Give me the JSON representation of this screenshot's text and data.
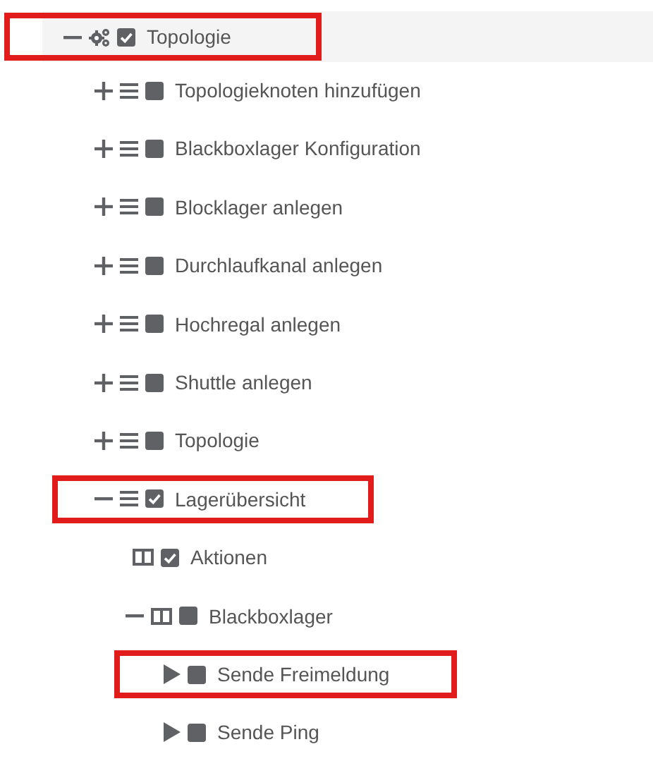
{
  "tree": [
    {
      "label": "Topologie",
      "kind": "module",
      "checked": true,
      "expanded": true,
      "selected": true,
      "highlighted": true,
      "children": [
        {
          "label": "Topologieknoten hinzufügen",
          "kind": "page",
          "checked": false,
          "expanded": false,
          "selected": false,
          "highlighted": false
        },
        {
          "label": "Blackboxlager Konfiguration",
          "kind": "page",
          "checked": false,
          "expanded": false,
          "selected": false,
          "highlighted": false
        },
        {
          "label": "Blocklager anlegen",
          "kind": "page",
          "checked": false,
          "expanded": false,
          "selected": false,
          "highlighted": false
        },
        {
          "label": "Durchlaufkanal anlegen",
          "kind": "page",
          "checked": false,
          "expanded": false,
          "selected": false,
          "highlighted": false
        },
        {
          "label": "Hochregal anlegen",
          "kind": "page",
          "checked": false,
          "expanded": false,
          "selected": false,
          "highlighted": false
        },
        {
          "label": "Shuttle anlegen",
          "kind": "page",
          "checked": false,
          "expanded": false,
          "selected": false,
          "highlighted": false
        },
        {
          "label": "Topologie",
          "kind": "page",
          "checked": false,
          "expanded": false,
          "selected": false,
          "highlighted": false
        },
        {
          "label": "Lagerübersicht",
          "kind": "page",
          "checked": true,
          "expanded": true,
          "selected": false,
          "highlighted": true,
          "children": [
            {
              "label": "Aktionen",
              "kind": "panel",
              "checked": true,
              "selected": false,
              "highlighted": false
            },
            {
              "label": "Blackboxlager",
              "kind": "panel",
              "checked": false,
              "expanded": true,
              "selected": false,
              "highlighted": false,
              "children": [
                {
                  "label": "Sende Freimeldung",
                  "kind": "action",
                  "checked": false,
                  "selected": false,
                  "highlighted": true
                },
                {
                  "label": "Sende Ping",
                  "kind": "action",
                  "checked": false,
                  "selected": false,
                  "highlighted": false
                }
              ]
            }
          ]
        }
      ]
    }
  ]
}
